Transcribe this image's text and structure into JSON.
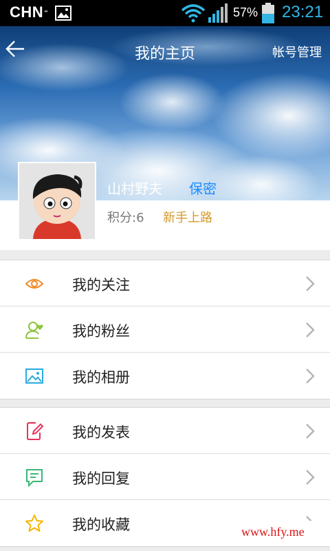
{
  "status_bar": {
    "carrier": "CHN",
    "carrier_suffix": "-",
    "battery_percent": "57%",
    "time": "23:21",
    "icons": [
      "image-icon",
      "wifi-icon",
      "signal-icon",
      "battery-icon"
    ]
  },
  "header": {
    "title": "我的主页",
    "back_icon": "back-arrow-icon",
    "account_link": "帐号管理"
  },
  "profile": {
    "username": "山村野夫",
    "privacy_label": "保密",
    "points": "积分:6",
    "level": "新手上路"
  },
  "menu_groups": [
    {
      "items": [
        {
          "label": "我的关注",
          "icon": "eye-icon",
          "color": "#f08a24"
        },
        {
          "label": "我的粉丝",
          "icon": "user-heart-icon",
          "color": "#8cc63f"
        },
        {
          "label": "我的相册",
          "icon": "photo-icon",
          "color": "#29abe2"
        }
      ]
    },
    {
      "items": [
        {
          "label": "我的发表",
          "icon": "edit-icon",
          "color": "#e8315b"
        },
        {
          "label": "我的回复",
          "icon": "comment-icon",
          "color": "#3cb878"
        },
        {
          "label": "我的收藏",
          "icon": "star-icon",
          "color": "#f7b500"
        }
      ]
    }
  ],
  "watermark": "www.hfy.me"
}
